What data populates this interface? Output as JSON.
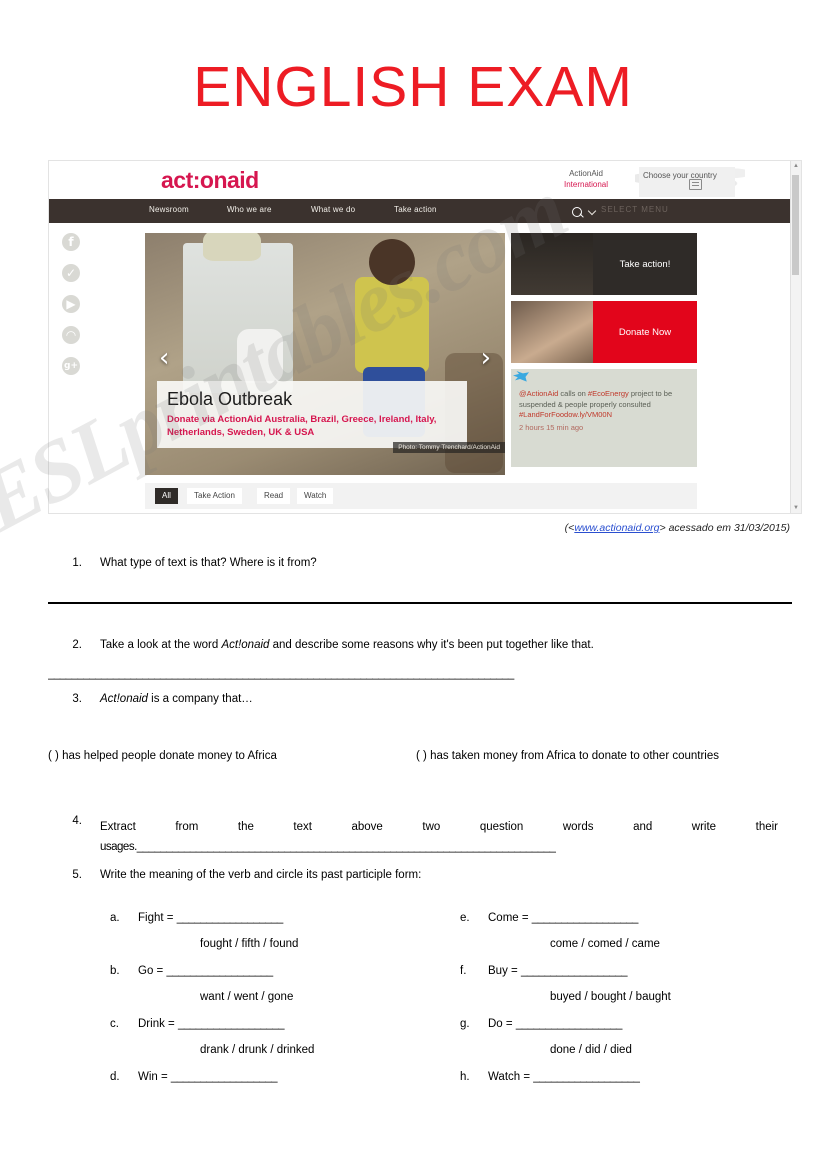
{
  "title": "ENGLISH EXAM",
  "watermark": "ESLprintables.com",
  "brand": {
    "red": "#ed1c24",
    "actionaid_red": "#d6164f",
    "nav_dark": "#3b322e",
    "link_blue": "#2a4fd0"
  },
  "screenshot": {
    "logo": "act:onaid",
    "region": {
      "line1": "ActionAid",
      "line2": "International"
    },
    "country_selector": "Choose your country",
    "nav": [
      {
        "label": "Newsroom"
      },
      {
        "label": "Who we are"
      },
      {
        "label": "What we do"
      },
      {
        "label": "Take action"
      }
    ],
    "search_icon": "search-icon",
    "select_menu": "SELECT MENU",
    "social": [
      {
        "name": "facebook-icon",
        "glyph": "f"
      },
      {
        "name": "twitter-icon",
        "glyph": "✓"
      },
      {
        "name": "youtube-icon",
        "glyph": "▶"
      },
      {
        "name": "rss-icon",
        "glyph": "◠"
      },
      {
        "name": "google-plus-icon",
        "glyph": "g+"
      }
    ],
    "hero": {
      "heading": "Ebola Outbreak",
      "subheading": "Donate via ActionAid Australia, Brazil, Greece, Ireland, Italy, Netherlands, Sweden, UK & USA",
      "credit": "Photo: Tommy Trenchard/ActionAid",
      "prev_arrow": "‹",
      "next_arrow": "›"
    },
    "cards": [
      {
        "label": "Take action!"
      },
      {
        "label": "Donate Now"
      }
    ],
    "tweet": {
      "handle": "@ActionAid",
      "text_1": " calls on ",
      "hashtag_1": "#EcoEnergy",
      "text_2": " project to be suspended & people properly consulted ",
      "hashtag_2": "#LandFor",
      "link": "Food",
      "link_tail": "ow.ly/VM00N",
      "time": "2 hours 15 min ago"
    },
    "filters": [
      {
        "label": "All",
        "active": true
      },
      {
        "label": "Take Action",
        "active": false
      },
      {
        "label": "Read",
        "active": false
      },
      {
        "label": "Watch",
        "active": false
      }
    ]
  },
  "source": {
    "prefix": "(<",
    "url": "www.actionaid.org",
    "suffix": "> acessado em 31/03/2015)"
  },
  "questions": {
    "q1": {
      "num": "1.",
      "text": "What type of text is that? Where is it from?"
    },
    "q2": {
      "num": "2.",
      "pre": "Take a look at the word ",
      "em": "Act!onaid",
      "post": " and describe some reasons why it's been put together like that."
    },
    "answer_line": "_______________________________________________________________________________",
    "q3": {
      "num": "3.",
      "em": "Act!onaid",
      "post": " is a company that…"
    },
    "q3_options": [
      {
        "marker": "(  )",
        "text": "has helped people donate money to Africa"
      },
      {
        "marker": "(  )",
        "text": "has taken money from Africa to donate to other countries"
      }
    ],
    "q4": {
      "num": "4.",
      "text": "Extract from the text above two question words and write their",
      "text_line2": "usages.",
      "line": "_______________________________________________________________________"
    },
    "q5": {
      "num": "5.",
      "text": "Write the meaning of the verb and circle its past participle form:"
    }
  },
  "verbs": {
    "blank": "__________________",
    "left": [
      {
        "letter": "a.",
        "verb": "Fight =",
        "alts": "fought / fifth / found"
      },
      {
        "letter": "b.",
        "verb": "Go =",
        "alts": "want / went / gone"
      },
      {
        "letter": "c.",
        "verb": "Drink =",
        "alts": "drank / drunk / drinked"
      },
      {
        "letter": "d.",
        "verb": "Win =",
        "alts": ""
      }
    ],
    "right": [
      {
        "letter": "e.",
        "verb": "Come =",
        "alts": "come / comed / came"
      },
      {
        "letter": "f.",
        "verb": "Buy =",
        "alts": "buyed / bought / baught"
      },
      {
        "letter": "g.",
        "verb": "Do =",
        "alts": "done / did / died"
      },
      {
        "letter": "h.",
        "verb": "Watch =",
        "alts": ""
      }
    ]
  }
}
